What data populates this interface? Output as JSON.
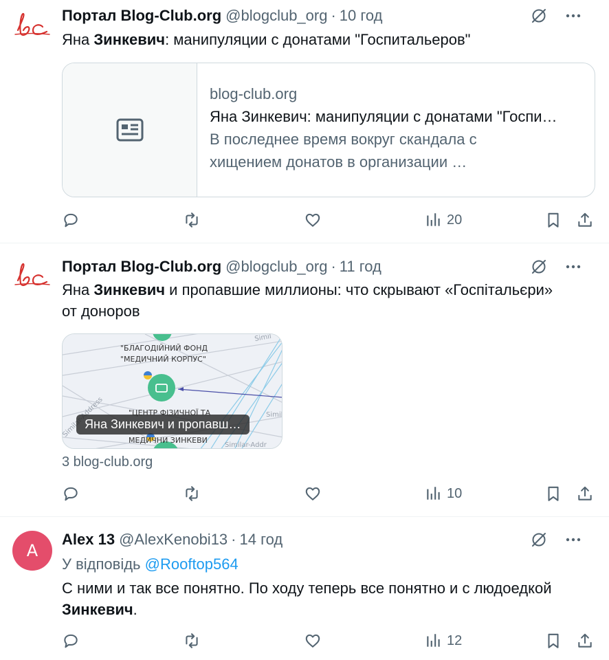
{
  "tweets": [
    {
      "name": "Портал Blog-Club.org",
      "handle": "@blogclub_org",
      "sep": "·",
      "time": "10 год",
      "text_prefix": "Яна ",
      "text_bold": "Зинкевич",
      "text_suffix": ": манипуляции с донатами \"Госпитальеров\"",
      "card": {
        "domain": "blog-club.org",
        "title": "Яна Зинкевич: манипуляции с донатами \"Госпи…",
        "desc_line1": "В последнее время вокруг скандала с",
        "desc_line2": "хищением донатов в организации …"
      },
      "views": "20"
    },
    {
      "name": "Портал Blog-Club.org",
      "handle": "@blogclub_org",
      "sep": "·",
      "time": "11 год",
      "text_prefix": "Яна ",
      "text_bold": "Зинкевич",
      "text_suffix": " и пропавшие миллионы: что скрывают «Госпітальєри»",
      "text_line2": "от доноров",
      "media": {
        "label_1": "\"БЛАГОДІЙНИЙ ФОНД",
        "label_2": "\"МЕДИЧНИЙ КОРПУС\"",
        "label_3": "\"ЦЕНТР ФІЗИЧНОЇ ТА",
        "label_4": "МЕДИЧНИ ЗИНКЕВИ",
        "watermark_1": "Simil",
        "watermark_2": "Similar-Address",
        "watermark_3": "Similar-Addr",
        "watermark_4": "Simil",
        "caption": "Яна Зинкевич и пропавш…"
      },
      "below_media": "3 blog-club.org",
      "views": "10"
    },
    {
      "name": "Alex 13",
      "handle": "@AlexKenobi13",
      "sep": "·",
      "time": "14 год",
      "avatar_letter": "A",
      "reply_prefix": "У відповідь ",
      "reply_mention": "@Rooftop564",
      "text_line1": "С ними и так все понятно. По ходу теперь все понятно и с людоедкой",
      "text_bold": "Зинкевич",
      "text_end": ".",
      "views": "12"
    }
  ],
  "icons": {
    "avatar_logo": "bc-logo",
    "grok": "grok-icon",
    "more": "more-icon",
    "reply": "reply-icon",
    "retweet": "retweet-icon",
    "like": "like-icon",
    "views": "views-icon",
    "bookmark": "bookmark-icon",
    "share": "share-icon",
    "card_placeholder": "article-icon"
  },
  "colors": {
    "link": "#1d9bf0",
    "secondary": "#536471",
    "logo": "#d6322f",
    "avatar_bg": "#e44d6b",
    "node": "#48bf8e"
  }
}
